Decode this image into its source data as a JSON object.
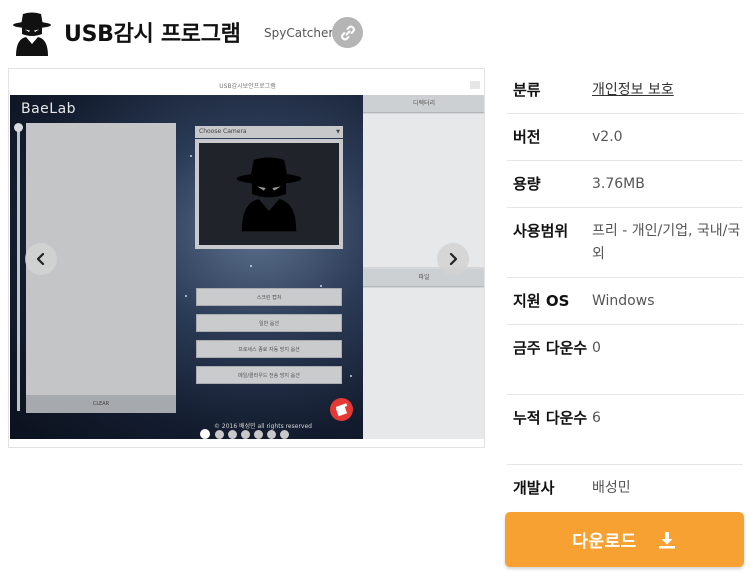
{
  "header": {
    "title": "USB감시 프로그램",
    "developer": "SpyCatcher",
    "link_icon": "link-icon",
    "app_icon": "spy-icon"
  },
  "screenshot": {
    "window_title": "USB감시보안프로그램",
    "brand": "BaeLab",
    "clear_label": "CLEAR",
    "camera_select": "Choose Camera",
    "buttons": [
      "스크린 캡쳐",
      "일반 옵션",
      "프로세스 종료 자동 방지 옵션",
      "메일/클라우드 전송 방지 옵션"
    ],
    "copyright": "© 2016  배성민 all rights reserved",
    "side_headers": [
      "디렉터리",
      "파일"
    ],
    "slide_count": 7,
    "active_slide": 1,
    "prev_icon": "chevron-left-icon",
    "next_icon": "chevron-right-icon"
  },
  "info": [
    {
      "label": "분류",
      "value": "개인정보 보호",
      "is_link": true
    },
    {
      "label": "버전",
      "value": "v2.0"
    },
    {
      "label": "용량",
      "value": "3.76MB"
    },
    {
      "label": "사용범위",
      "value": "프리 - 개인/기업, 국내/국외"
    },
    {
      "label": "지원 OS",
      "value": "Windows"
    },
    {
      "label": "금주 다운수",
      "value": "0"
    },
    {
      "label": "누적 다운수",
      "value": "6"
    },
    {
      "label": "개발사",
      "value": "배성민"
    }
  ],
  "download": {
    "label": "다운로드",
    "icon": "download-icon"
  },
  "colors": {
    "accent": "#f7a133",
    "link_button": "#b5b5b5",
    "gift_badge": "#e53935"
  }
}
